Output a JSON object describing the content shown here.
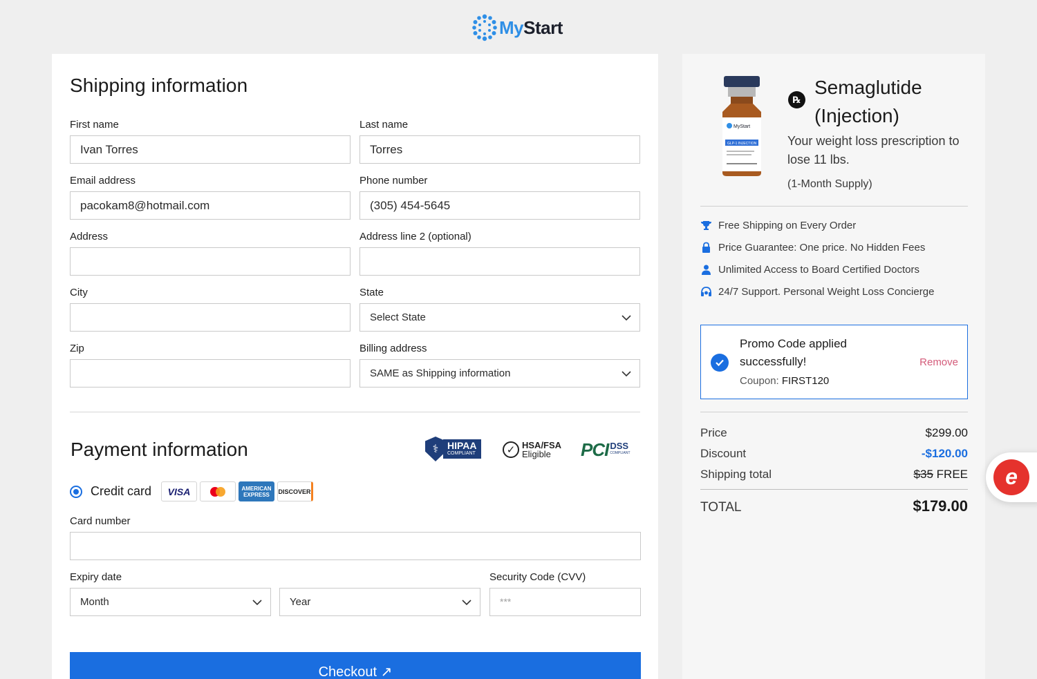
{
  "brand": {
    "name_part1": "My",
    "name_part2": "Start",
    "color_primary": "#2f8fe6",
    "color_dark": "#1b1f2b"
  },
  "shipping": {
    "title": "Shipping information",
    "first_name": {
      "label": "First name",
      "value": "Ivan Torres"
    },
    "last_name": {
      "label": "Last name",
      "value": "Torres"
    },
    "email": {
      "label": "Email address",
      "value": "pacokam8@hotmail.com"
    },
    "phone": {
      "label": "Phone number",
      "value": "(305) 454-5645"
    },
    "address": {
      "label": "Address",
      "value": ""
    },
    "address2": {
      "label": "Address line 2 (optional)",
      "value": ""
    },
    "city": {
      "label": "City",
      "value": ""
    },
    "state": {
      "label": "State",
      "value": "Select State"
    },
    "zip": {
      "label": "Zip",
      "value": ""
    },
    "billing": {
      "label": "Billing address",
      "value": "SAME as Shipping information"
    }
  },
  "payment": {
    "title": "Payment information",
    "badges": {
      "hipaa": "HIPAA",
      "hipaa_sub": "COMPLIANT",
      "hsa_line1": "HSA/FSA",
      "hsa_line2": "Eligible",
      "pci": "PCI",
      "dss": "DSS",
      "dss_sub": "COMPLIANT"
    },
    "method_label": "Credit card",
    "cards": {
      "visa": "VISA",
      "amex_line1": "AMERICAN",
      "amex_line2": "EXPRESS",
      "discover": "DISCOVER"
    },
    "card_number": {
      "label": "Card number",
      "value": ""
    },
    "expiry": {
      "label": "Expiry date",
      "month": "Month",
      "year": "Year"
    },
    "cvv": {
      "label": "Security Code (CVV)",
      "placeholder": "***"
    },
    "checkout_label": "Checkout ↗"
  },
  "product": {
    "rx": "℞",
    "title": "Semaglutide (Injection)",
    "description": "Your weight loss prescription to lose 11 lbs.",
    "supply": "(1-Month Supply)",
    "vial_brand": "MyStart",
    "vial_label": "GLP-1 INJECTION"
  },
  "features": [
    {
      "icon": "trophy-icon",
      "text": "Free Shipping on Every Order"
    },
    {
      "icon": "lock-icon",
      "text": "Price Guarantee: One price. No Hidden Fees"
    },
    {
      "icon": "doctor-icon",
      "text": "Unlimited Access to Board Certified Doctors"
    },
    {
      "icon": "support-icon",
      "text": "24/7 Support. Personal Weight Loss Concierge"
    }
  ],
  "promo": {
    "message": "Promo Code applied successfully!",
    "coupon_label": "Coupon:",
    "coupon_code": "FIRST120",
    "remove": "Remove"
  },
  "summary": {
    "price_label": "Price",
    "price": "$299.00",
    "discount_label": "Discount",
    "discount": "-$120.00",
    "shipping_label": "Shipping total",
    "shipping_old": "$35",
    "shipping_new": "FREE",
    "total_label": "TOTAL",
    "total": "$179.00",
    "accent_color": "#1a6ee0"
  },
  "chat": {
    "glyph": "e"
  }
}
